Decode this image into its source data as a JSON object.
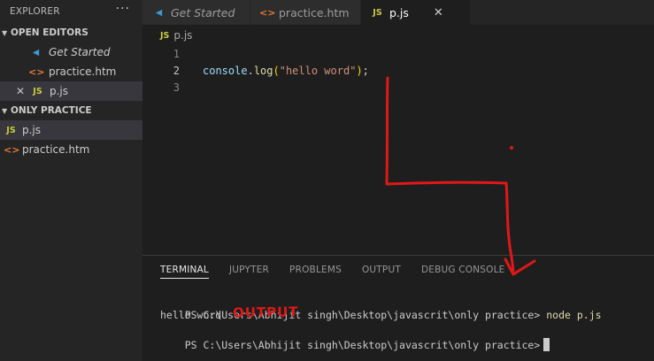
{
  "sidebar": {
    "title": "EXPLORER",
    "more_label": "···",
    "open_editors": {
      "title": "OPEN EDITORS",
      "items": [
        {
          "label": "Get Started",
          "icon": "vscode-icon"
        },
        {
          "label": "practice.htm",
          "icon": "html-icon"
        },
        {
          "label": "p.js",
          "icon": "js-icon",
          "close": "✕"
        }
      ]
    },
    "folder": {
      "title": "ONLY PRACTICE",
      "items": [
        {
          "label": "p.js",
          "icon": "js-icon"
        },
        {
          "label": "practice.htm",
          "icon": "html-icon"
        }
      ]
    }
  },
  "tabs": [
    {
      "label": "Get Started",
      "icon": "vscode-icon"
    },
    {
      "label": "practice.htm",
      "icon": "html-icon"
    },
    {
      "label": "p.js",
      "icon": "js-icon",
      "close": "✕"
    }
  ],
  "icon_text": {
    "js": "JS",
    "html": "<>",
    "vscode": "◀"
  },
  "breadcrumb": {
    "file": "p.js"
  },
  "editor": {
    "lines": [
      {
        "number": "1",
        "code": ""
      },
      {
        "number": "2",
        "fn": "console",
        "dot": ".",
        "method": "log",
        "open": "(",
        "str": "\"hello word\"",
        "close": ")",
        "end": ";"
      },
      {
        "number": "3",
        "code": ""
      }
    ]
  },
  "panel": {
    "tabs": [
      "TERMINAL",
      "JUPYTER",
      "PROBLEMS",
      "OUTPUT",
      "DEBUG CONSOLE"
    ],
    "terminal": {
      "prompt1": "PS C:\\Users\\Abhijit singh\\Desktop\\javascrit\\only practice>",
      "command": "node p.js",
      "output": "hello word",
      "prompt2": "PS C:\\Users\\Abhijit singh\\Desktop\\javascrit\\only practice>"
    }
  },
  "annotation": {
    "text": "OUTPUT",
    "color": "#e01818"
  },
  "colors": {
    "sidebar_bg": "#252526",
    "editor_bg": "#1e1e1e",
    "selected_item": "#37373d",
    "js_icon": "#cbcb41",
    "html_icon": "#e37933",
    "annotation_red": "#e01818"
  }
}
